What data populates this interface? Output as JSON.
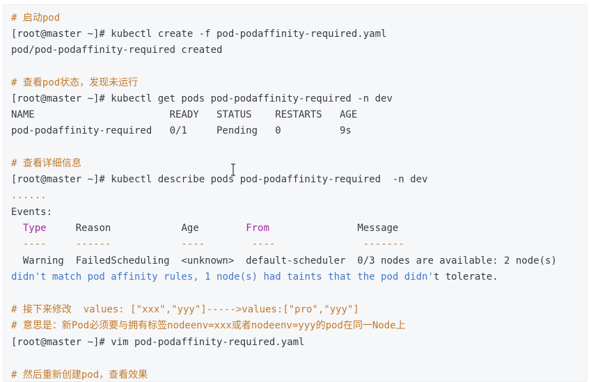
{
  "code": {
    "l1": "# 启动pod",
    "l2": "[root@master ~]# kubectl create -f pod-podaffinity-required.yaml",
    "l3": "pod/pod-podaffinity-required created",
    "l5": "# 查看pod状态，发现未运行",
    "l6": "[root@master ~]# kubectl get pods pod-podaffinity-required -n dev",
    "l7": "NAME                       READY   STATUS    RESTARTS   AGE",
    "l8": "pod-podaffinity-required   0/1     Pending   0          9s",
    "l10": "# 查看详细信息",
    "l11": "[root@master ~]# kubectl describe pods pod-podaffinity-required  -n dev",
    "l12": "......",
    "l13": "Events:",
    "l14_type": "Type",
    "l14_reason": "Reason",
    "l14_age": "Age",
    "l14_from": "From",
    "l14_message": "Message",
    "l15_dashes1": "----",
    "l15_dashes2": "------",
    "l15_dashes3": "----",
    "l15_dashes4": "----",
    "l15_dashes5": "-------",
    "l16": "  Warning  FailedScheduling  <unknown>  default-scheduler  0/3 nodes are available: 2 node(s)",
    "l17_a": "didn",
    "l17_b": "'t match pod affinity rules, 1 node(s) had taints that the pod didn'",
    "l17_c": "t tolerate.",
    "l19": "# 接下来修改  values: [\"xxx\",\"yyy\"]----->values:[\"pro\",\"yyy\"]",
    "l20": "# 意思是：新Pod必须要与拥有标签nodeenv=xxx或者nodeenv=yyy的pod在同一Node上",
    "l21": "[root@master ~]# vim pod-podaffinity-required.yaml",
    "l23": "# 然后重新创建pod，查看效果"
  }
}
